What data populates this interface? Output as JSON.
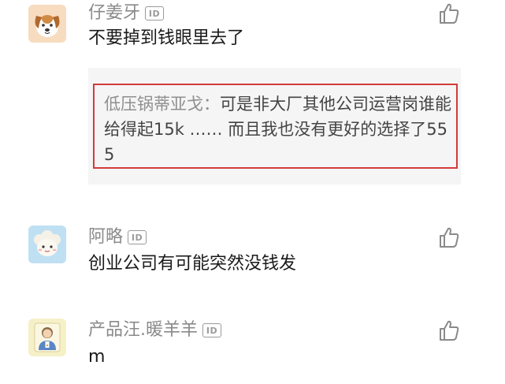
{
  "comments": [
    {
      "username": "仔姜牙",
      "badge": "ID",
      "text": "不要掉到钱眼里去了",
      "avatar_icon": "dog-icon",
      "quote": {
        "author": "低压锅蒂亚戈：",
        "text": "可是非大厂其他公司运营岗谁能给得起15k …… 而且我也没有更好的选择了555"
      }
    },
    {
      "username": "阿略",
      "badge": "ID",
      "text": "创业公司有可能突然没钱发",
      "avatar_icon": "sheep-icon"
    },
    {
      "username": "产品汪.暖羊羊",
      "badge": "ID",
      "text": "m",
      "avatar_icon": "person-icon"
    }
  ],
  "colors": {
    "username": "#8a8a8a",
    "text": "#1a1a1a",
    "quote_bg": "#f5f5f5",
    "highlight": "#d43a3a"
  }
}
